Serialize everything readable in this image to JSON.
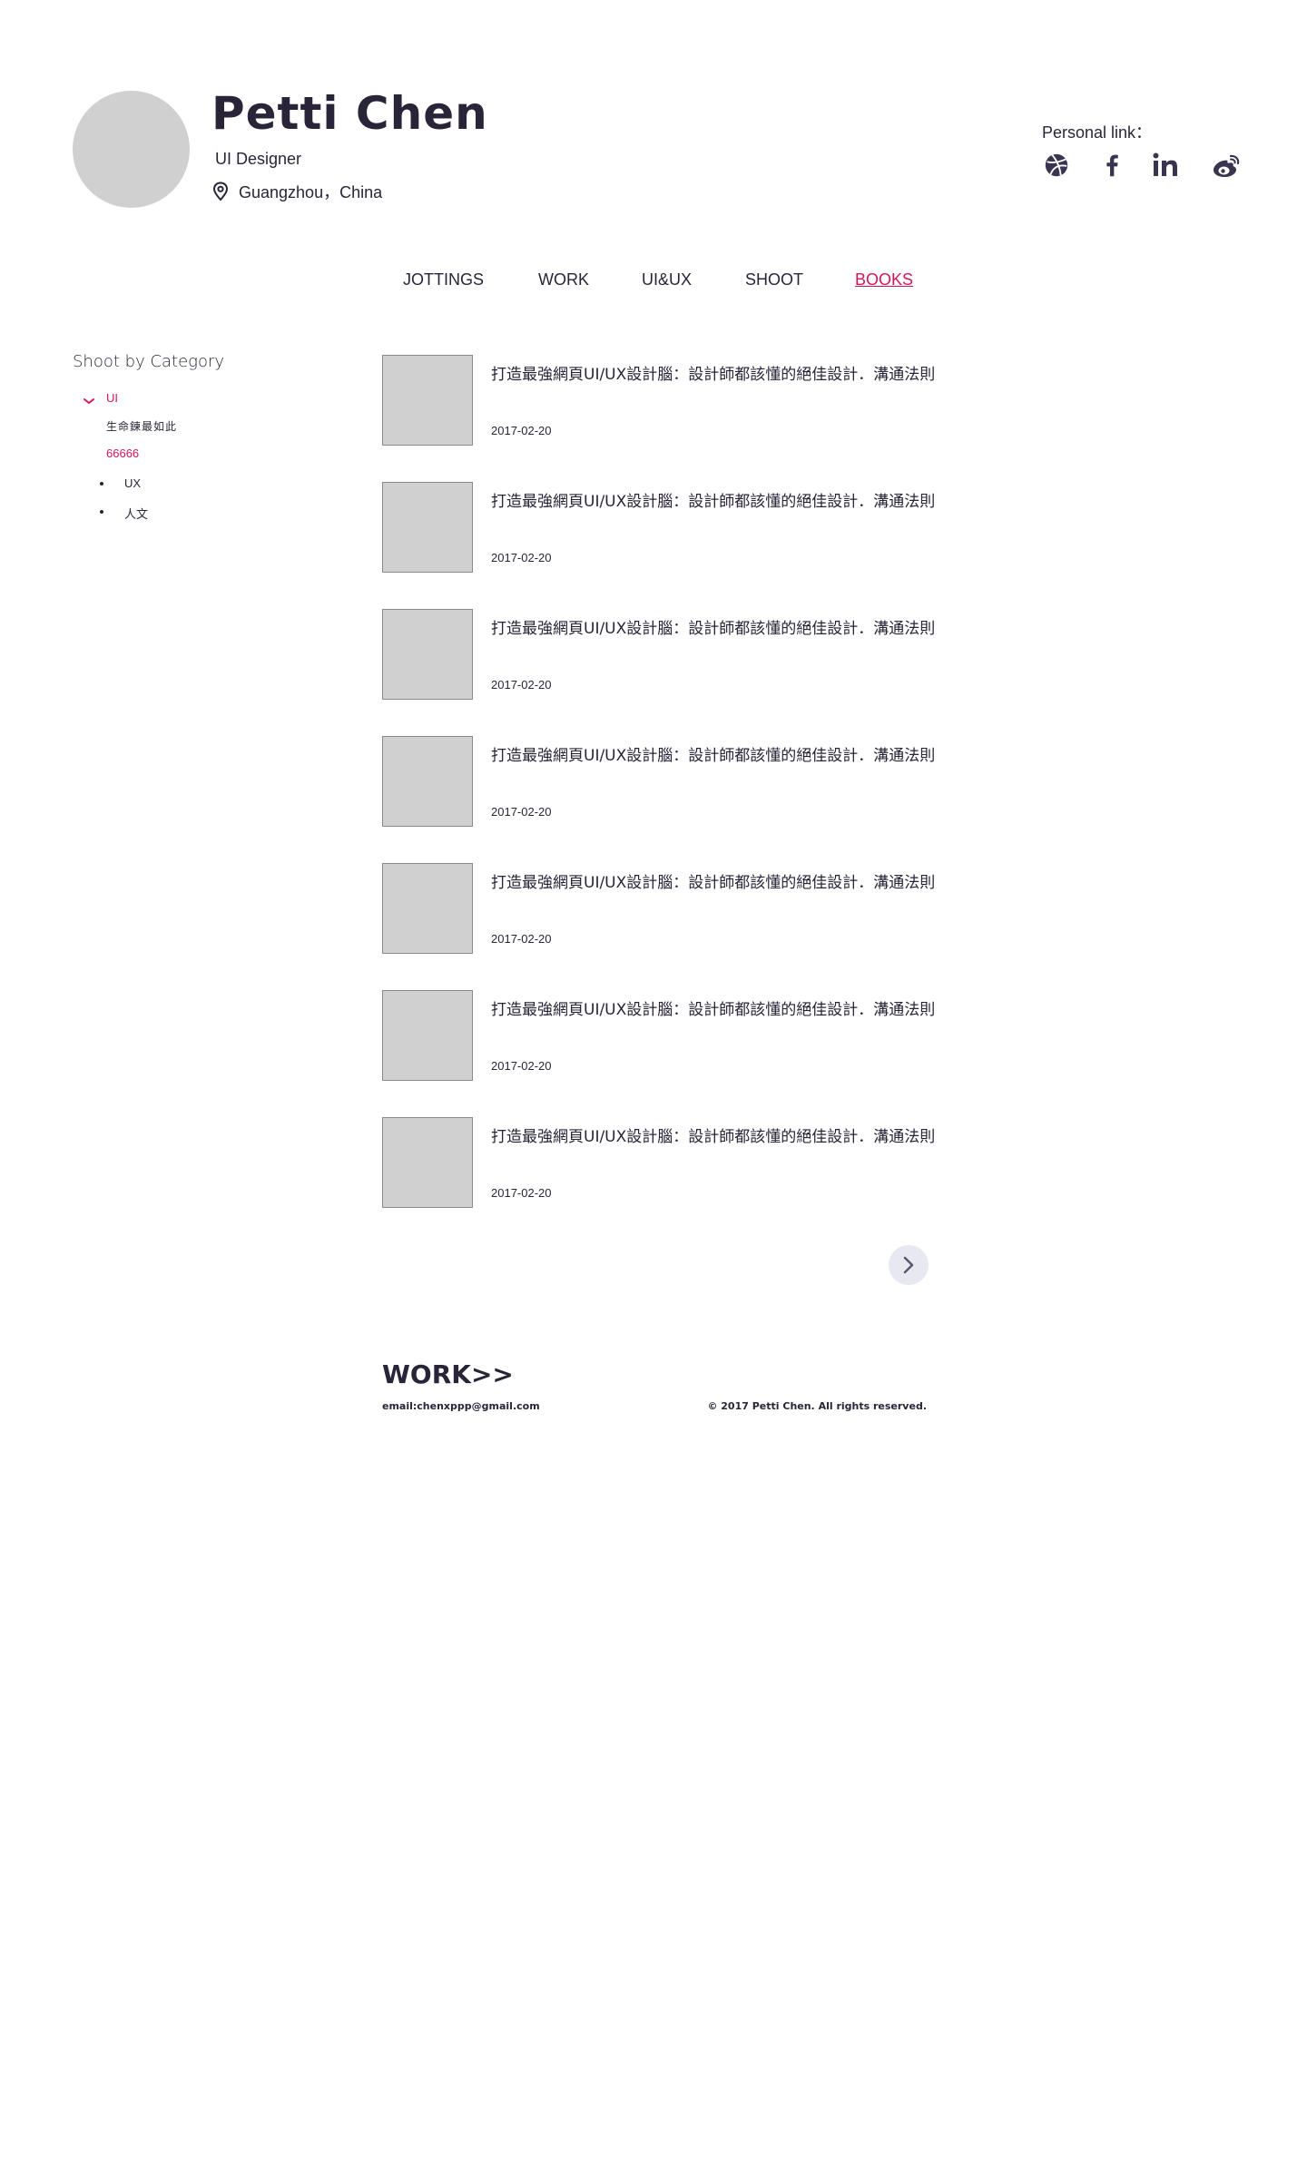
{
  "profile": {
    "name": "Petti Chen",
    "role": "UI Designer",
    "location": "Guangzhou，China"
  },
  "personal_links": {
    "label": "Personal link：",
    "icons": [
      "dribbble-icon",
      "facebook-icon",
      "linkedin-icon",
      "weibo-icon"
    ]
  },
  "nav": {
    "items": [
      "JOTTINGS",
      "WORK",
      "UI&UX",
      "SHOOT",
      "BOOKS"
    ],
    "active": "BOOKS"
  },
  "sidebar": {
    "title": "Shoot by Category",
    "categories": [
      {
        "label": "UI",
        "expanded": true
      },
      {
        "label": "生命鍊最如此"
      },
      {
        "label": "66666"
      },
      {
        "label": "UX"
      },
      {
        "label": "人文"
      }
    ]
  },
  "articles": [
    {
      "title": "打造最強網頁UI/UX設計腦：設計師都該懂的絕佳設計．溝通法則",
      "date": "2017-02-20"
    },
    {
      "title": "打造最強網頁UI/UX設計腦：設計師都該懂的絕佳設計．溝通法則",
      "date": "2017-02-20"
    },
    {
      "title": "打造最強網頁UI/UX設計腦：設計師都該懂的絕佳設計．溝通法則",
      "date": "2017-02-20"
    },
    {
      "title": "打造最強網頁UI/UX設計腦：設計師都該懂的絕佳設計．溝通法則",
      "date": "2017-02-20"
    },
    {
      "title": "打造最強網頁UI/UX設計腦：設計師都該懂的絕佳設計．溝通法則",
      "date": "2017-02-20"
    },
    {
      "title": "打造最強網頁UI/UX設計腦：設計師都該懂的絕佳設計．溝通法則",
      "date": "2017-02-20"
    },
    {
      "title": "打造最強網頁UI/UX設計腦：設計師都該懂的絕佳設計．溝通法則",
      "date": "2017-02-20"
    }
  ],
  "pagination": {
    "next_icon": "chevron-right-icon"
  },
  "footer": {
    "work_link": "WORK>>",
    "email": "email:chenxppp@gmail.com",
    "copyright": "© 2017 Petti Chen. All rights reserved."
  },
  "colors": {
    "text": "#2a2438",
    "accent": "#d6155a",
    "placeholder": "#d0d0d0"
  }
}
